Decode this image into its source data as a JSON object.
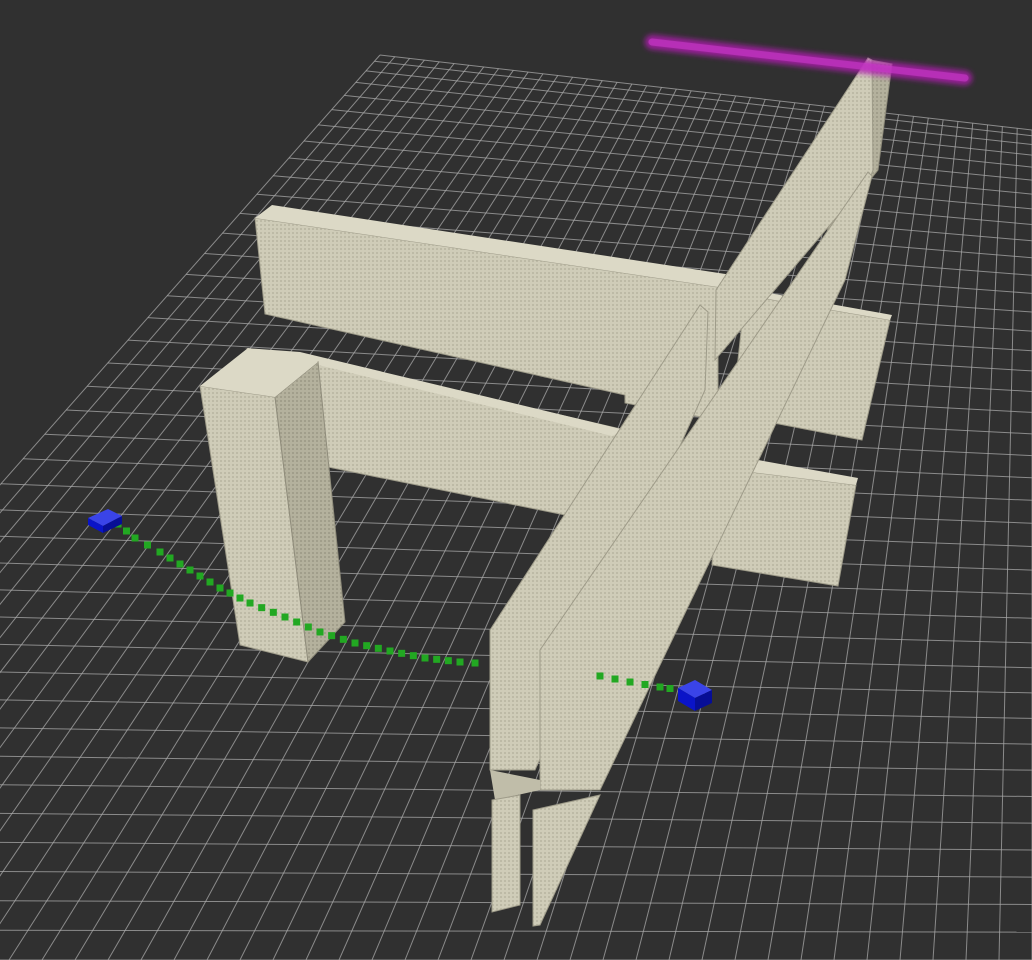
{
  "scene": {
    "background_color": "#303030",
    "grid_color": "#a9a9a9",
    "wall_color": "#cfccb8",
    "wall_shade_color": "#b9b6a3",
    "wall_dark_color": "#a9a794",
    "path_color": "#22a822",
    "marker_color": "#0a14c8",
    "goal_bar_color": "#b21fb2"
  },
  "objects": {
    "grid": "ground-plane-grid",
    "walls": "voxel-wall-obstacles",
    "planned_path": "dotted-path",
    "start_marker": "cube-marker",
    "goal_marker": "cube-marker",
    "goal_bar": "glow-bar"
  }
}
